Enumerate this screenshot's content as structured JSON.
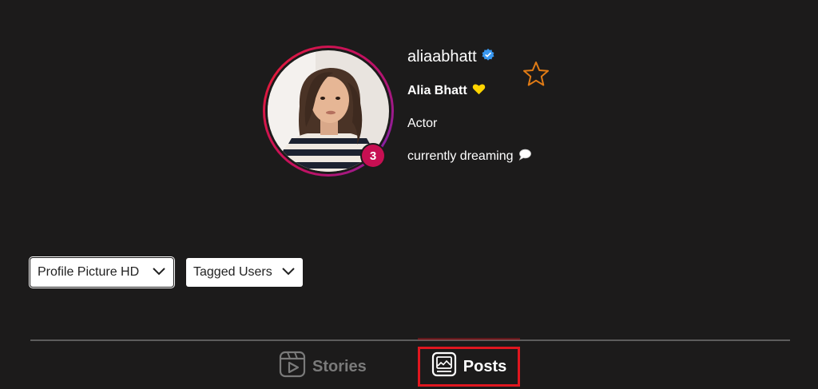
{
  "profile": {
    "username": "aliaabhatt",
    "full_name": "Alia Bhatt",
    "category": "Actor",
    "bio": "currently dreaming",
    "story_count": "3",
    "verified": true
  },
  "buttons": {
    "profile_picture_hd": "Profile Picture HD",
    "tagged_users": "Tagged Users"
  },
  "tabs": [
    {
      "label": "Stories",
      "active": false
    },
    {
      "label": "Posts",
      "active": true
    }
  ],
  "colors": {
    "background": "#1c1b1b",
    "verified": "#3897f0",
    "heart": "#ffd400",
    "star_outline": "#e07b15",
    "highlight": "#e0161f",
    "story_ring": "#c5105d"
  },
  "icons": [
    "verified-icon",
    "yellow-heart-icon",
    "star-icon",
    "speech-bubble-icon",
    "chevron-down-icon",
    "stories-icon",
    "posts-icon"
  ]
}
